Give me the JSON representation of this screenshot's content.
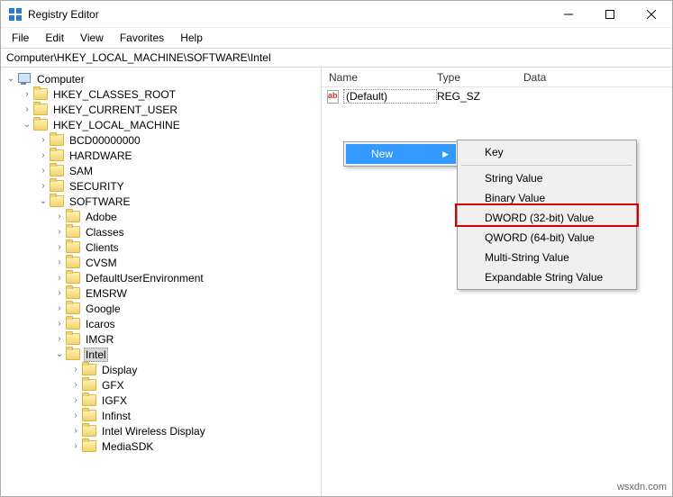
{
  "title": "Registry Editor",
  "menubar": [
    "File",
    "Edit",
    "View",
    "Favorites",
    "Help"
  ],
  "address": "Computer\\HKEY_LOCAL_MACHINE\\SOFTWARE\\Intel",
  "columns": {
    "name": "Name",
    "type": "Type",
    "data": "Data"
  },
  "tree": {
    "root": "Computer",
    "hkcr": "HKEY_CLASSES_ROOT",
    "hkcu": "HKEY_CURRENT_USER",
    "hklm": "HKEY_LOCAL_MACHINE",
    "hklm_children": [
      "BCD00000000",
      "HARDWARE",
      "SAM",
      "SECURITY",
      "SOFTWARE"
    ],
    "software_children": [
      "Adobe",
      "Classes",
      "Clients",
      "CVSM",
      "DefaultUserEnvironment",
      "EMSRW",
      "Google",
      "Icaros",
      "IMGR",
      "Intel"
    ],
    "intel_children": [
      "Display",
      "GFX",
      "IGFX",
      "Infinst",
      "Intel Wireless Display",
      "MediaSDK"
    ]
  },
  "list": {
    "default_name": "(Default)",
    "default_type": "REG_SZ"
  },
  "ctx": {
    "new": "New"
  },
  "submenu": [
    "Key",
    "String Value",
    "Binary Value",
    "DWORD (32-bit) Value",
    "QWORD (64-bit) Value",
    "Multi-String Value",
    "Expandable String Value"
  ],
  "watermark": "wsxdn.com"
}
